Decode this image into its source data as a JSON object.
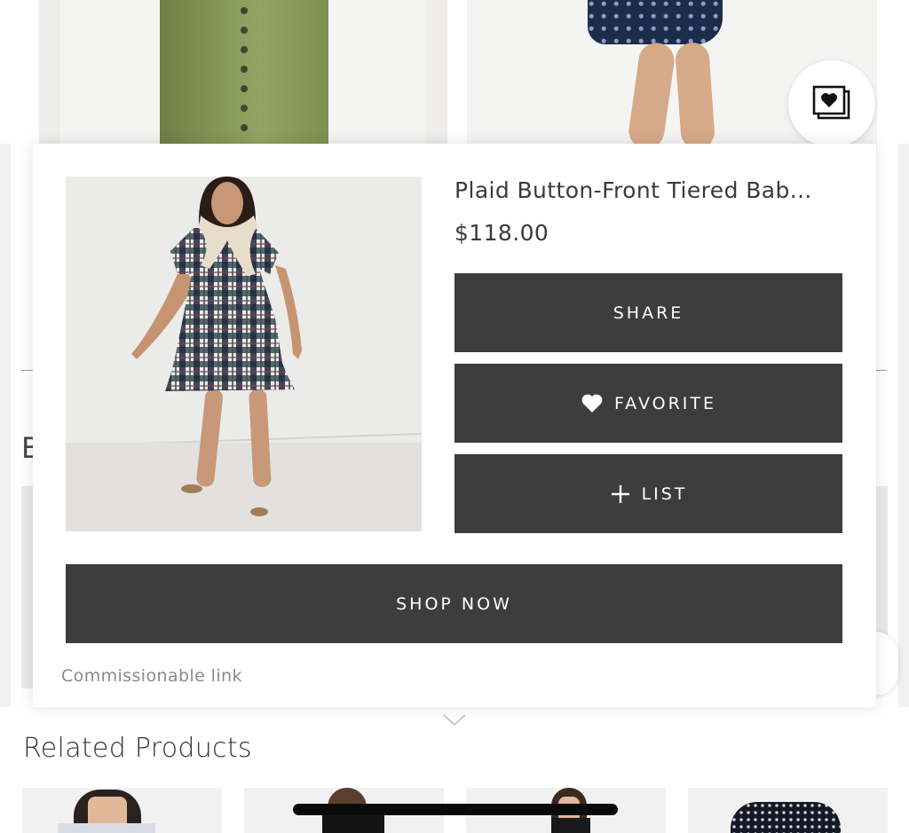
{
  "modal": {
    "product_title": "Plaid Button-Front Tiered Bab...",
    "price": "$118.00",
    "buttons": {
      "share": "SHARE",
      "favorite": "FAVORITE",
      "list": "LIST",
      "shop_now": "SHOP NOW"
    },
    "commission_note": "Commissionable link"
  },
  "background": {
    "partial_heading_letter": "B",
    "related_products_title": "Related Products"
  },
  "icons": {
    "save": "photo-heart-stack-icon",
    "favorite": "heart-icon",
    "list": "plus-icon",
    "expand": "chevron-down-icon"
  },
  "colors": {
    "button_bg": "#3d3d3d",
    "button_text": "#ffffff",
    "muted_text": "#8a8a8a"
  }
}
